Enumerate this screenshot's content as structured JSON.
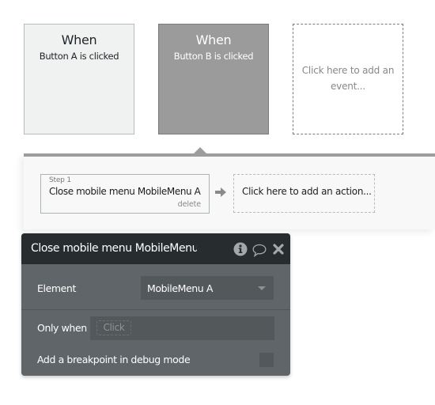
{
  "events": [
    {
      "when": "When",
      "trigger": "Button A is clicked",
      "state": "normal"
    },
    {
      "when": "When",
      "trigger": "Button B is clicked",
      "state": "selected"
    }
  ],
  "add_event": {
    "label": "Click here to add an event..."
  },
  "workflow": {
    "steps": [
      {
        "step_label": "Step 1",
        "title": "Close mobile menu MobileMenu A",
        "delete_label": "delete"
      }
    ],
    "add_action": {
      "label": "Click here to add an action..."
    }
  },
  "editor": {
    "title": "Close mobile menu MobileMenu A",
    "icons": [
      "info-icon",
      "comment-icon",
      "close-icon"
    ],
    "element": {
      "label": "Element",
      "value": "MobileMenu A"
    },
    "only_when": {
      "label": "Only when",
      "placeholder": "Click"
    },
    "breakpoint": {
      "label": "Add a breakpoint in debug mode",
      "checked": false
    }
  },
  "colors": {
    "selected_event_bg": "#9b9b9b",
    "editor_header_bg": "#272c2f",
    "editor_body_bg": "#606569",
    "field_bg": "#53585b"
  }
}
